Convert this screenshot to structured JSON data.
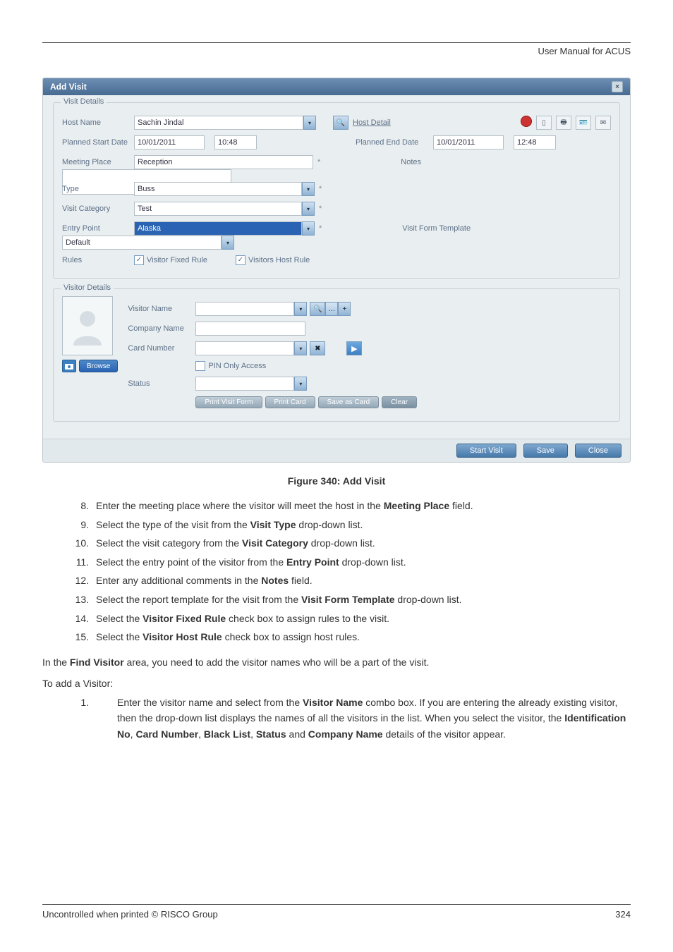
{
  "header": {
    "doc_title": "User Manual for ACUS"
  },
  "window": {
    "title": "Add Visit"
  },
  "visit_details": {
    "legend": "Visit Details",
    "host_name_lbl": "Host Name",
    "host_name_val": "Sachin Jindal",
    "host_detail_lbl": "Host Detail",
    "planned_start_lbl": "Planned Start Date",
    "planned_start_date": "10/01/2011",
    "planned_start_time": "10:48",
    "planned_end_lbl": "Planned End Date",
    "planned_end_date": "10/01/2011",
    "planned_end_time": "12:48",
    "meeting_place_lbl": "Meeting Place",
    "meeting_place_val": "Reception",
    "notes_lbl": "Notes",
    "notes_val": "",
    "type_lbl": "Type",
    "type_val": "Buss",
    "visit_category_lbl": "Visit Category",
    "visit_category_val": "Test",
    "entry_point_lbl": "Entry Point",
    "entry_point_val": "Alaska",
    "template_lbl": "Visit Form Template",
    "template_val": "Default",
    "rules_lbl": "Rules",
    "visitor_fixed_rule": "Visitor Fixed Rule",
    "visitors_host_rule": "Visitors Host Rule"
  },
  "visitor_details": {
    "legend": "Visitor Details",
    "visitor_name_lbl": "Visitor Name",
    "company_name_lbl": "Company Name",
    "card_number_lbl": "Card Number",
    "pin_only_lbl": "PIN Only Access",
    "status_lbl": "Status",
    "browse_btn": "Browse",
    "print_form_btn": "Print Visit Form",
    "print_card_btn": "Print Card",
    "save_card_btn": "Save as Card",
    "clear_btn": "Clear"
  },
  "footer_btns": {
    "start_visit": "Start Visit",
    "save": "Save",
    "close": "Close"
  },
  "caption": "Figure 340: Add Visit",
  "steps": [
    "Enter the meeting place where the visitor will meet the host in the <b>Meeting Place</b> field.",
    "Select the type of the visit from the <b>Visit Type</b> drop-down list.",
    "Select the visit category from the <b>Visit Category</b> drop-down list.",
    "Select the entry point of the visitor from the <b>Entry Point</b> drop-down list.",
    "Enter any additional comments in the <b>Notes</b> field.",
    "Select the report template for the visit from the <b>Visit Form Template</b> drop-down list.",
    "Select the <b>Visitor Fixed Rule</b> check box to assign rules to the visit.",
    "Select the <b>Visitor Host Rule</b> check box to assign host rules."
  ],
  "find_visitor_intro": "In the <b>Find Visitor</b> area, you need to add the visitor names who will be a part of the visit.",
  "to_add": "To add a Visitor:",
  "substeps": [
    "Enter the visitor name and select from the <b>Visitor Name</b> combo box. If you are entering the already existing visitor, then the drop-down list displays the names of all the visitors in the list. When you select the visitor, the <b>Identification No</b>, <b>Card Number</b>, <b>Black List</b>, <b>Status</b> and <b>Company Name</b> details of the visitor appear."
  ],
  "page_footer": {
    "left": "Uncontrolled when printed © RISCO Group",
    "right": "324"
  }
}
